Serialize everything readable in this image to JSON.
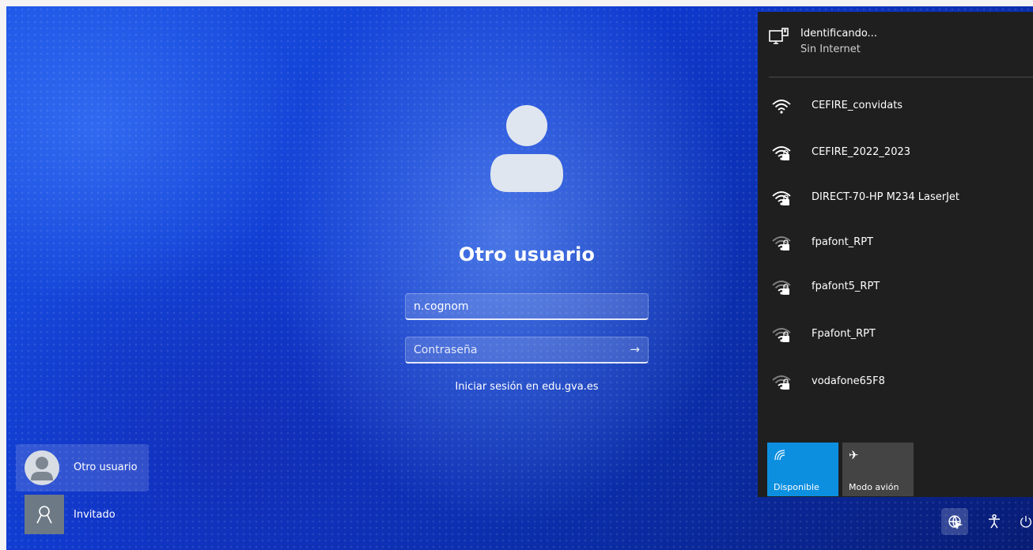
{
  "login": {
    "title": "Otro usuario",
    "username_value": "n.cognom",
    "password_placeholder": "Contraseña",
    "signin_domain_text": "Iniciar sesión en edu.gva.es"
  },
  "user_switcher": {
    "current_user": "Otro usuario",
    "guest_user": "Invitado"
  },
  "network_flyout": {
    "status_title": "Identificando...",
    "status_subtitle": "Sin Internet",
    "networks": [
      {
        "name": "CEFIRE_convidats",
        "secured": false
      },
      {
        "name": "CEFIRE_2022_2023",
        "secured": true
      },
      {
        "name": "DIRECT-70-HP M234 LaserJet",
        "secured": true
      },
      {
        "name": "fpafont_RPT",
        "secured": true
      },
      {
        "name": "fpafont5_RPT",
        "secured": true
      },
      {
        "name": "Fpafont_RPT",
        "secured": true
      },
      {
        "name": "vodafone65F8",
        "secured": true
      }
    ],
    "quick_actions": {
      "wifi_label": "Disponible",
      "airplane_label": "Modo avión"
    }
  },
  "taskbar": {
    "icons": [
      "network-icon",
      "accessibility-icon",
      "power-icon"
    ]
  },
  "colors": {
    "accent": "#0d8fe0",
    "panel_bg": "#1f1f1f",
    "wallpaper": "#0f3ad0"
  }
}
